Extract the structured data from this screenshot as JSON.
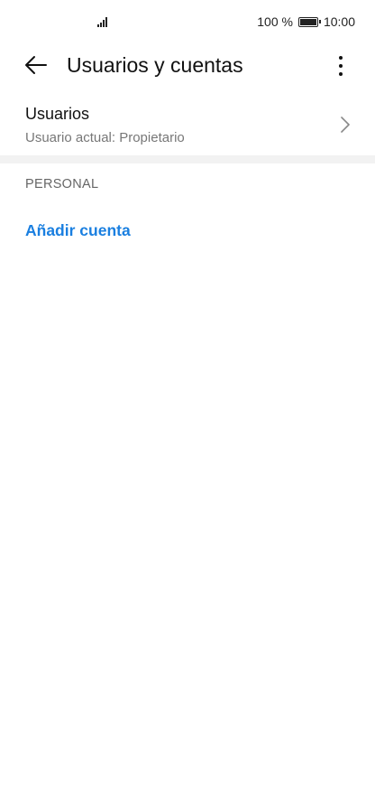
{
  "status_bar": {
    "battery_text": "100 %",
    "time": "10:00"
  },
  "app_bar": {
    "title": "Usuarios y cuentas",
    "back_icon": "arrow-left-icon",
    "more_icon": "more-vertical-icon"
  },
  "users": {
    "title": "Usuarios",
    "subtitle": "Usuario actual: Propietario"
  },
  "section": {
    "personal_label": "PERSONAL"
  },
  "actions": {
    "add_account": "Añadir cuenta"
  },
  "colors": {
    "accent": "#1a7fe0",
    "divider": "#f2f2f2"
  }
}
